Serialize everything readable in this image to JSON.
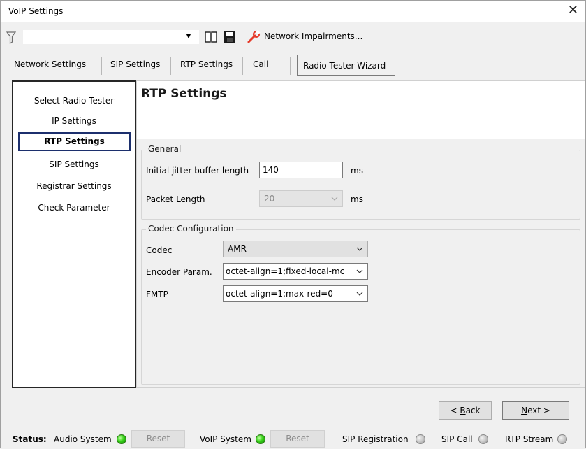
{
  "window": {
    "title": "VoIP Settings",
    "close_glyph": "✕"
  },
  "toolbar": {
    "filter_icon": "filter-icon",
    "filter_value": "",
    "network_impairments_label": "Network Impairments..."
  },
  "tabs": [
    {
      "label": "Network Settings"
    },
    {
      "label": "SIP Settings"
    },
    {
      "label": "RTP Settings"
    },
    {
      "label": "Call"
    },
    {
      "label": "Radio Tester Wizard",
      "active": true
    }
  ],
  "wizard_nav": [
    {
      "label": "Select Radio Tester"
    },
    {
      "label": "IP Settings"
    },
    {
      "label": "RTP Settings",
      "selected": true
    },
    {
      "label": "SIP Settings"
    },
    {
      "label": "Registrar Settings"
    },
    {
      "label": "Check Parameter"
    }
  ],
  "page": {
    "title": "RTP Settings",
    "general": {
      "title": "General",
      "jitter_label": "Initial jitter buffer length",
      "jitter_value": "140",
      "jitter_unit": "ms",
      "packet_label": "Packet Length",
      "packet_value": "20",
      "packet_unit": "ms"
    },
    "codec": {
      "title": "Codec Configuration",
      "codec_label": "Codec",
      "codec_value": "AMR",
      "encoder_label": "Encoder Param.",
      "encoder_value": "octet-align=1;fixed-local-mc",
      "fmtp_label": "FMTP",
      "fmtp_value": "octet-align=1;max-red=0"
    }
  },
  "nav_buttons": {
    "back_prefix": "< ",
    "back_key": "B",
    "back_rest": "ack",
    "next_key": "N",
    "next_rest": "ext >"
  },
  "status": {
    "label": "Status:",
    "audio_system": "Audio System",
    "reset": "Reset",
    "voip_system": "VoIP System",
    "sip_registration": "SIP Registration",
    "sip_call": "SIP Call",
    "rtp_stream_key": "R",
    "rtp_stream_rest": "TP Stream",
    "colors": {
      "ok": "#37d019",
      "idle": "#c4c4c4"
    }
  }
}
